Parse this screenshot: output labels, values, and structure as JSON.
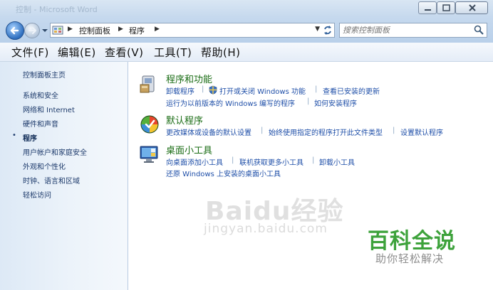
{
  "window": {
    "title": "控制 - Microsoft Word"
  },
  "address": {
    "crumbs": [
      "控制面板",
      "程序"
    ],
    "search_placeholder": "搜索控制面板"
  },
  "menu": {
    "file": "文件(F)",
    "edit": "编辑(E)",
    "view": "查看(V)",
    "tools": "工具(T)",
    "help": "帮助(H)"
  },
  "sidebar": {
    "home": "控制面板主页",
    "items": [
      "系统和安全",
      "网络和 Internet",
      "硬件和声音",
      "程序",
      "用户帐户和家庭安全",
      "外观和个性化",
      "时钟、语言和区域",
      "轻松访问"
    ],
    "active": "程序"
  },
  "categories": {
    "programs": {
      "title": "程序和功能",
      "links": [
        "卸载程序",
        "打开或关闭 Windows 功能",
        "查看已安装的更新",
        "运行为以前版本的 Windows 编写的程序",
        "如何安装程序"
      ]
    },
    "defaults": {
      "title": "默认程序",
      "links": [
        "更改媒体或设备的默认设置",
        "始终使用指定的程序打开此文件类型",
        "设置默认程序"
      ]
    },
    "gadgets": {
      "title": "桌面小工具",
      "links": [
        "向桌面添加小工具",
        "联机获取更多小工具",
        "卸载小工具",
        "还原 Windows 上安装的桌面小工具"
      ]
    }
  },
  "watermark": {
    "baidu": "Baidu经验",
    "jingyan": "jingyan.baidu.com",
    "brand": "百科全说",
    "slogan": "助你轻松解决"
  },
  "colors": {
    "category_title": "#1a6c14",
    "link": "#1f4fa8",
    "sidebar_link": "#1d3a6b",
    "brand": "#3da23b"
  },
  "icons": [
    "back-arrow-icon",
    "forward-arrow-icon",
    "control-panel-icon",
    "refresh-icon",
    "search-icon",
    "programs-icon",
    "default-programs-icon",
    "gadgets-icon",
    "shield-icon"
  ]
}
